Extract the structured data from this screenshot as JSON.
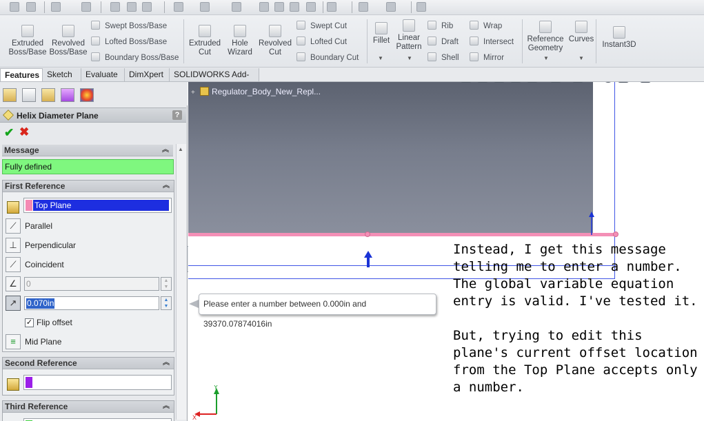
{
  "ribbon": {
    "extruded_boss": "Extruded\nBoss/Base",
    "revolved_boss": "Revolved\nBoss/Base",
    "swept_boss": "Swept Boss/Base",
    "lofted_boss": "Lofted Boss/Base",
    "boundary_boss": "Boundary Boss/Base",
    "extruded_cut": "Extruded\nCut",
    "hole_wizard": "Hole\nWizard",
    "revolved_cut": "Revolved\nCut",
    "swept_cut": "Swept Cut",
    "lofted_cut": "Lofted Cut",
    "boundary_cut": "Boundary Cut",
    "fillet": "Fillet",
    "linear_pattern": "Linear\nPattern",
    "rib": "Rib",
    "draft": "Draft",
    "shell": "Shell",
    "wrap": "Wrap",
    "intersect": "Intersect",
    "mirror": "Mirror",
    "reference_geometry": "Reference\nGeometry",
    "curves": "Curves",
    "instant3d": "Instant3D"
  },
  "tabs": [
    "Features",
    "Sketch",
    "Evaluate",
    "DimXpert",
    "SOLIDWORKS Add-Ins"
  ],
  "property_manager": {
    "title": "Helix Diameter Plane",
    "help": "?",
    "ok": "✔",
    "cancel": "✖",
    "message": {
      "header": "Message",
      "text": "Fully defined"
    },
    "first_reference": {
      "header": "First Reference",
      "selection": "Top Plane",
      "options": [
        "Parallel",
        "Perpendicular",
        "Coincident"
      ],
      "angle_value": "0",
      "offset_value": "0.070in",
      "flip_offset_label": "Flip offset",
      "flip_offset_checked": true,
      "mid_plane_label": "Mid Plane"
    },
    "second_reference": {
      "header": "Second Reference"
    },
    "third_reference": {
      "header": "Third Reference"
    }
  },
  "viewport": {
    "tree_root": "Regulator_Body_New_Repl...",
    "triad_y": "Y",
    "triad_x": "X"
  },
  "tooltip": "Please enter a number between 0.000in and 39370.07874016in",
  "note": {
    "para1": "Instead, I get this message telling me to enter a number. The global variable equation entry is valid. I've tested it.",
    "para2": "But, trying to edit this plane's current offset location from the Top Plane accepts only a number."
  },
  "colors": {
    "fully_defined": "#7ff77f",
    "selection_pink": "#f58ab4",
    "selection_purple": "#9b1fe8",
    "plane_edge": "#f48fb6",
    "plane_frame": "#4055e6"
  }
}
